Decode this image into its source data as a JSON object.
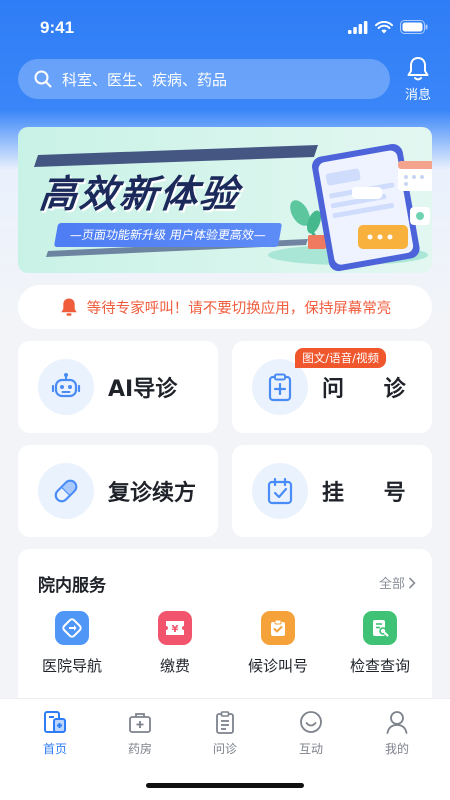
{
  "status_bar": {
    "time": "9:41"
  },
  "header": {
    "search_placeholder": "科室、医生、疾病、药品",
    "message_label": "消息"
  },
  "banner": {
    "title": "高效新体验",
    "subtitle": "—页面功能新升级 用户体验更高效—"
  },
  "notice": {
    "text": "等待专家呼叫！请不要切换应用，保持屏幕常亮"
  },
  "quick_actions": [
    {
      "label": "AI导诊",
      "icon": "robot-icon"
    },
    {
      "label": "问 诊",
      "icon": "clipboard-plus-icon",
      "tag": "图文/语音/视频"
    },
    {
      "label": "复诊续方",
      "icon": "pill-icon"
    },
    {
      "label": "挂 号",
      "icon": "calendar-check-icon"
    }
  ],
  "services": {
    "title": "院内服务",
    "more_label": "全部",
    "items": [
      {
        "label": "医院导航",
        "icon": "navigation-icon",
        "color": "#4f96f7"
      },
      {
        "label": "缴费",
        "icon": "payment-icon",
        "color": "#f3546d"
      },
      {
        "label": "候诊叫号",
        "icon": "queue-icon",
        "color": "#f6a23a"
      },
      {
        "label": "检查查询",
        "icon": "report-search-icon",
        "color": "#3fc276"
      }
    ]
  },
  "tabbar": {
    "items": [
      {
        "label": "首页",
        "icon": "home-icon",
        "active": true
      },
      {
        "label": "药房",
        "icon": "pharmacy-icon",
        "active": false
      },
      {
        "label": "问诊",
        "icon": "consult-icon",
        "active": false
      },
      {
        "label": "互动",
        "icon": "smile-icon",
        "active": false
      },
      {
        "label": "我的",
        "icon": "user-icon",
        "active": false
      }
    ]
  },
  "colors": {
    "primary": "#2f7df6",
    "notice": "#ef5d3d",
    "tag": "#f0572d"
  }
}
